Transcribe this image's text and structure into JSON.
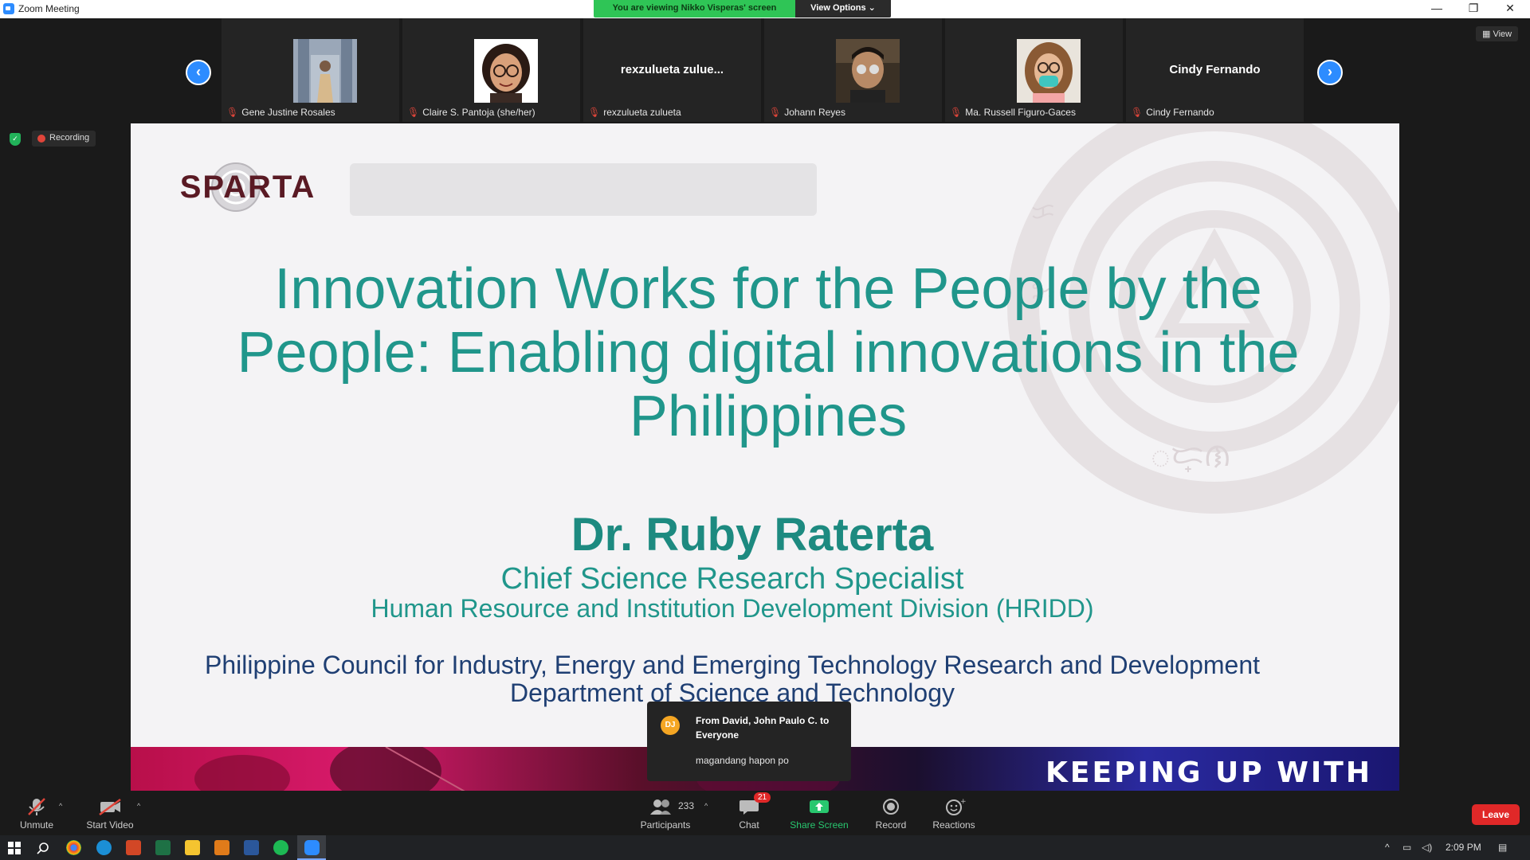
{
  "window": {
    "title": "Zoom Meeting",
    "viewing_banner": "You are viewing Nikko Visperas' screen",
    "view_options": "View Options",
    "view_options_chevron": "⌄"
  },
  "meeting": {
    "view_label": "View",
    "recording_label": "Recording",
    "participants": [
      {
        "name": "Gene Justine Rosales",
        "has_video_thumb": true
      },
      {
        "name": "Claire S. Pantoja (she/her)",
        "has_video_thumb": true
      },
      {
        "name": "rexzulueta zulueta",
        "display_label": "rexzulueta  zulue...",
        "has_video_thumb": false
      },
      {
        "name": "Johann Reyes",
        "has_video_thumb": true
      },
      {
        "name": "Ma. Russell Figuro-Gaces",
        "has_video_thumb": true
      },
      {
        "name": "Cindy Fernando",
        "display_label": "Cindy Fernando",
        "has_video_thumb": false
      }
    ]
  },
  "slide": {
    "logo_text": "SPARTA",
    "title": "Innovation Works for the People by the People: Enabling digital innovations in the Philippines",
    "speaker_name": "Dr. Ruby Raterta",
    "speaker_role": "Chief Science Research Specialist",
    "speaker_division": "Human Resource and Institution Development Division (HRIDD)",
    "agency_line1": "Philippine Council for Industry, Energy and Emerging Technology Research and Development",
    "agency_line2": "Department of Science and Technology",
    "agency_line3_visible": "T)",
    "banner_text": "KEEPING UP WITH"
  },
  "chat_popup": {
    "avatar_initials": "DJ",
    "from": "From David, John Paulo C. to Everyone",
    "message": "magandang hapon po"
  },
  "toolbar": {
    "unmute": "Unmute",
    "start_video": "Start Video",
    "participants": "Participants",
    "participants_count": "233",
    "chat": "Chat",
    "chat_badge": "21",
    "share_screen": "Share Screen",
    "record": "Record",
    "reactions": "Reactions",
    "leave": "Leave"
  },
  "taskbar": {
    "time": "2:09 PM"
  },
  "colors": {
    "accent_blue": "#2d8cff",
    "banner_green": "#2fc556",
    "slide_teal": "#20968b",
    "slide_navy": "#1f3f73",
    "leave_red": "#e02828"
  }
}
